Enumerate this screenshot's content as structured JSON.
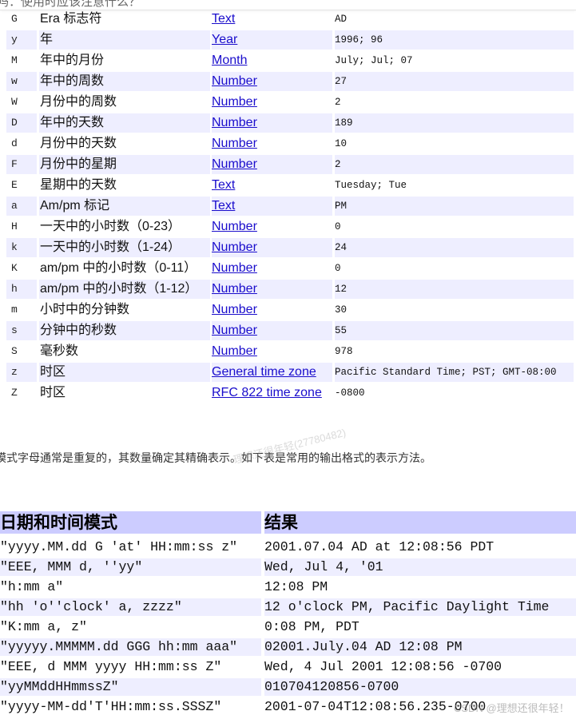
{
  "header": {
    "title": "吗：使用时应该注意什么？"
  },
  "pattern_letters": [
    {
      "letter": "G",
      "desc": "Era 标志符",
      "type": "Text",
      "example": "AD"
    },
    {
      "letter": "y",
      "desc": "年",
      "type": "Year",
      "example": "1996; 96"
    },
    {
      "letter": "M",
      "desc": "年中的月份",
      "type": "Month",
      "example": "July; Jul; 07"
    },
    {
      "letter": "w",
      "desc": "年中的周数",
      "type": "Number",
      "example": "27"
    },
    {
      "letter": "W",
      "desc": "月份中的周数",
      "type": "Number",
      "example": "2"
    },
    {
      "letter": "D",
      "desc": "年中的天数",
      "type": "Number",
      "example": "189"
    },
    {
      "letter": "d",
      "desc": "月份中的天数",
      "type": "Number",
      "example": "10"
    },
    {
      "letter": "F",
      "desc": "月份中的星期",
      "type": "Number",
      "example": "2"
    },
    {
      "letter": "E",
      "desc": "星期中的天数",
      "type": "Text",
      "example": "Tuesday; Tue"
    },
    {
      "letter": "a",
      "desc": "Am/pm 标记",
      "type": "Text",
      "example": "PM"
    },
    {
      "letter": "H",
      "desc": "一天中的小时数（0-23）",
      "type": "Number",
      "example": "0"
    },
    {
      "letter": "k",
      "desc": "一天中的小时数（1-24）",
      "type": "Number",
      "example": "24"
    },
    {
      "letter": "K",
      "desc": "am/pm 中的小时数（0-11）",
      "type": "Number",
      "example": "0"
    },
    {
      "letter": "h",
      "desc": "am/pm 中的小时数（1-12）",
      "type": "Number",
      "example": "12"
    },
    {
      "letter": "m",
      "desc": "小时中的分钟数",
      "type": "Number",
      "example": "30"
    },
    {
      "letter": "s",
      "desc": "分钟中的秒数",
      "type": "Number",
      "example": "55"
    },
    {
      "letter": "S",
      "desc": "毫秒数",
      "type": "Number",
      "example": "978"
    },
    {
      "letter": "z",
      "desc": "时区",
      "type": "General time zone",
      "example": "Pacific Standard Time; PST; GMT-08:00"
    },
    {
      "letter": "Z",
      "desc": "时区",
      "type": "RFC 822 time zone",
      "example": "-0800"
    }
  ],
  "paragraph": "模式字母通常是重复的，其数量确定其精确表示。如下表是常用的输出格式的表示方法。",
  "watermark_mid": "理想还很年轻(27780482)",
  "examples": {
    "headers": [
      "日期和时间模式",
      "结果"
    ],
    "rows": [
      {
        "pattern": "\"yyyy.MM.dd G 'at' HH:mm:ss z\"",
        "result": "2001.07.04 AD at 12:08:56 PDT"
      },
      {
        "pattern": "\"EEE, MMM d, ''yy\"",
        "result": "Wed, Jul 4, '01"
      },
      {
        "pattern": "\"h:mm a\"",
        "result": "12:08 PM"
      },
      {
        "pattern": "\"hh 'o''clock' a, zzzz\"",
        "result": "12 o'clock PM, Pacific Daylight Time"
      },
      {
        "pattern": "\"K:mm a, z\"",
        "result": "0:08 PM, PDT"
      },
      {
        "pattern": "\"yyyyy.MMMMM.dd GGG hh:mm aaa\"",
        "result": "02001.July.04 AD 12:08 PM"
      },
      {
        "pattern": "\"EEE, d MMM yyyy HH:mm:ss Z\"",
        "result": "Wed, 4 Jul 2001 12:08:56 -0700"
      },
      {
        "pattern": "\"yyMMddHHmmssZ\"",
        "result": "010704120856-0700"
      },
      {
        "pattern": "\"yyyy-MM-dd'T'HH:mm:ss.SSSZ\"",
        "result": "2001-07-04T12:08:56.235-0700"
      }
    ]
  },
  "watermark_bottom": "CSDN @理想还很年轻！",
  "colors": {
    "row_shade": "#eeeeff",
    "header_bg": "#ccccff",
    "link": "#1a0dcc"
  }
}
